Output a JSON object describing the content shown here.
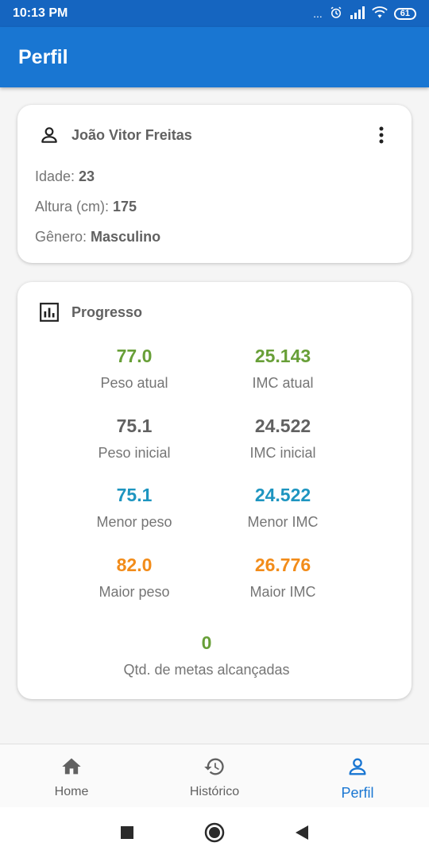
{
  "status_bar": {
    "time": "10:13 PM",
    "signal_dots": "...",
    "battery": "61"
  },
  "app_bar": {
    "title": "Perfil"
  },
  "profile": {
    "name": "João Vitor Freitas",
    "age_label": "Idade: ",
    "age_value": "23",
    "height_label": "Altura (cm): ",
    "height_value": "175",
    "gender_label": "Gênero: ",
    "gender_value": "Masculino",
    "icons": {
      "user": "person-outline-icon",
      "menu": "more-vert-icon"
    }
  },
  "progress": {
    "title": "Progresso",
    "icon": "bar-chart-icon",
    "stats": [
      {
        "value": "77.0",
        "label": "Peso atual",
        "color": "#689f38"
      },
      {
        "value": "25.143",
        "label": "IMC atual",
        "color": "#689f38"
      },
      {
        "value": "75.1",
        "label": "Peso inicial",
        "color": "#616161"
      },
      {
        "value": "24.522",
        "label": "IMC inicial",
        "color": "#616161"
      },
      {
        "value": "75.1",
        "label": "Menor peso",
        "color": "#1e95c0"
      },
      {
        "value": "24.522",
        "label": "Menor IMC",
        "color": "#1e95c0"
      },
      {
        "value": "82.0",
        "label": "Maior peso",
        "color": "#f28c1a"
      },
      {
        "value": "26.776",
        "label": "Maior IMC",
        "color": "#f28c1a"
      }
    ],
    "goals": {
      "value": "0",
      "label": "Qtd. de metas alcançadas",
      "color": "#689f38"
    }
  },
  "bottom_nav": [
    {
      "label": "Home",
      "icon": "home-icon",
      "active": false
    },
    {
      "label": "Histórico",
      "icon": "history-icon",
      "active": false
    },
    {
      "label": "Perfil",
      "icon": "person-icon",
      "active": true
    }
  ],
  "colors": {
    "primary": "#1976d2",
    "status_bar": "#1565c0",
    "background": "#f5f5f5"
  }
}
